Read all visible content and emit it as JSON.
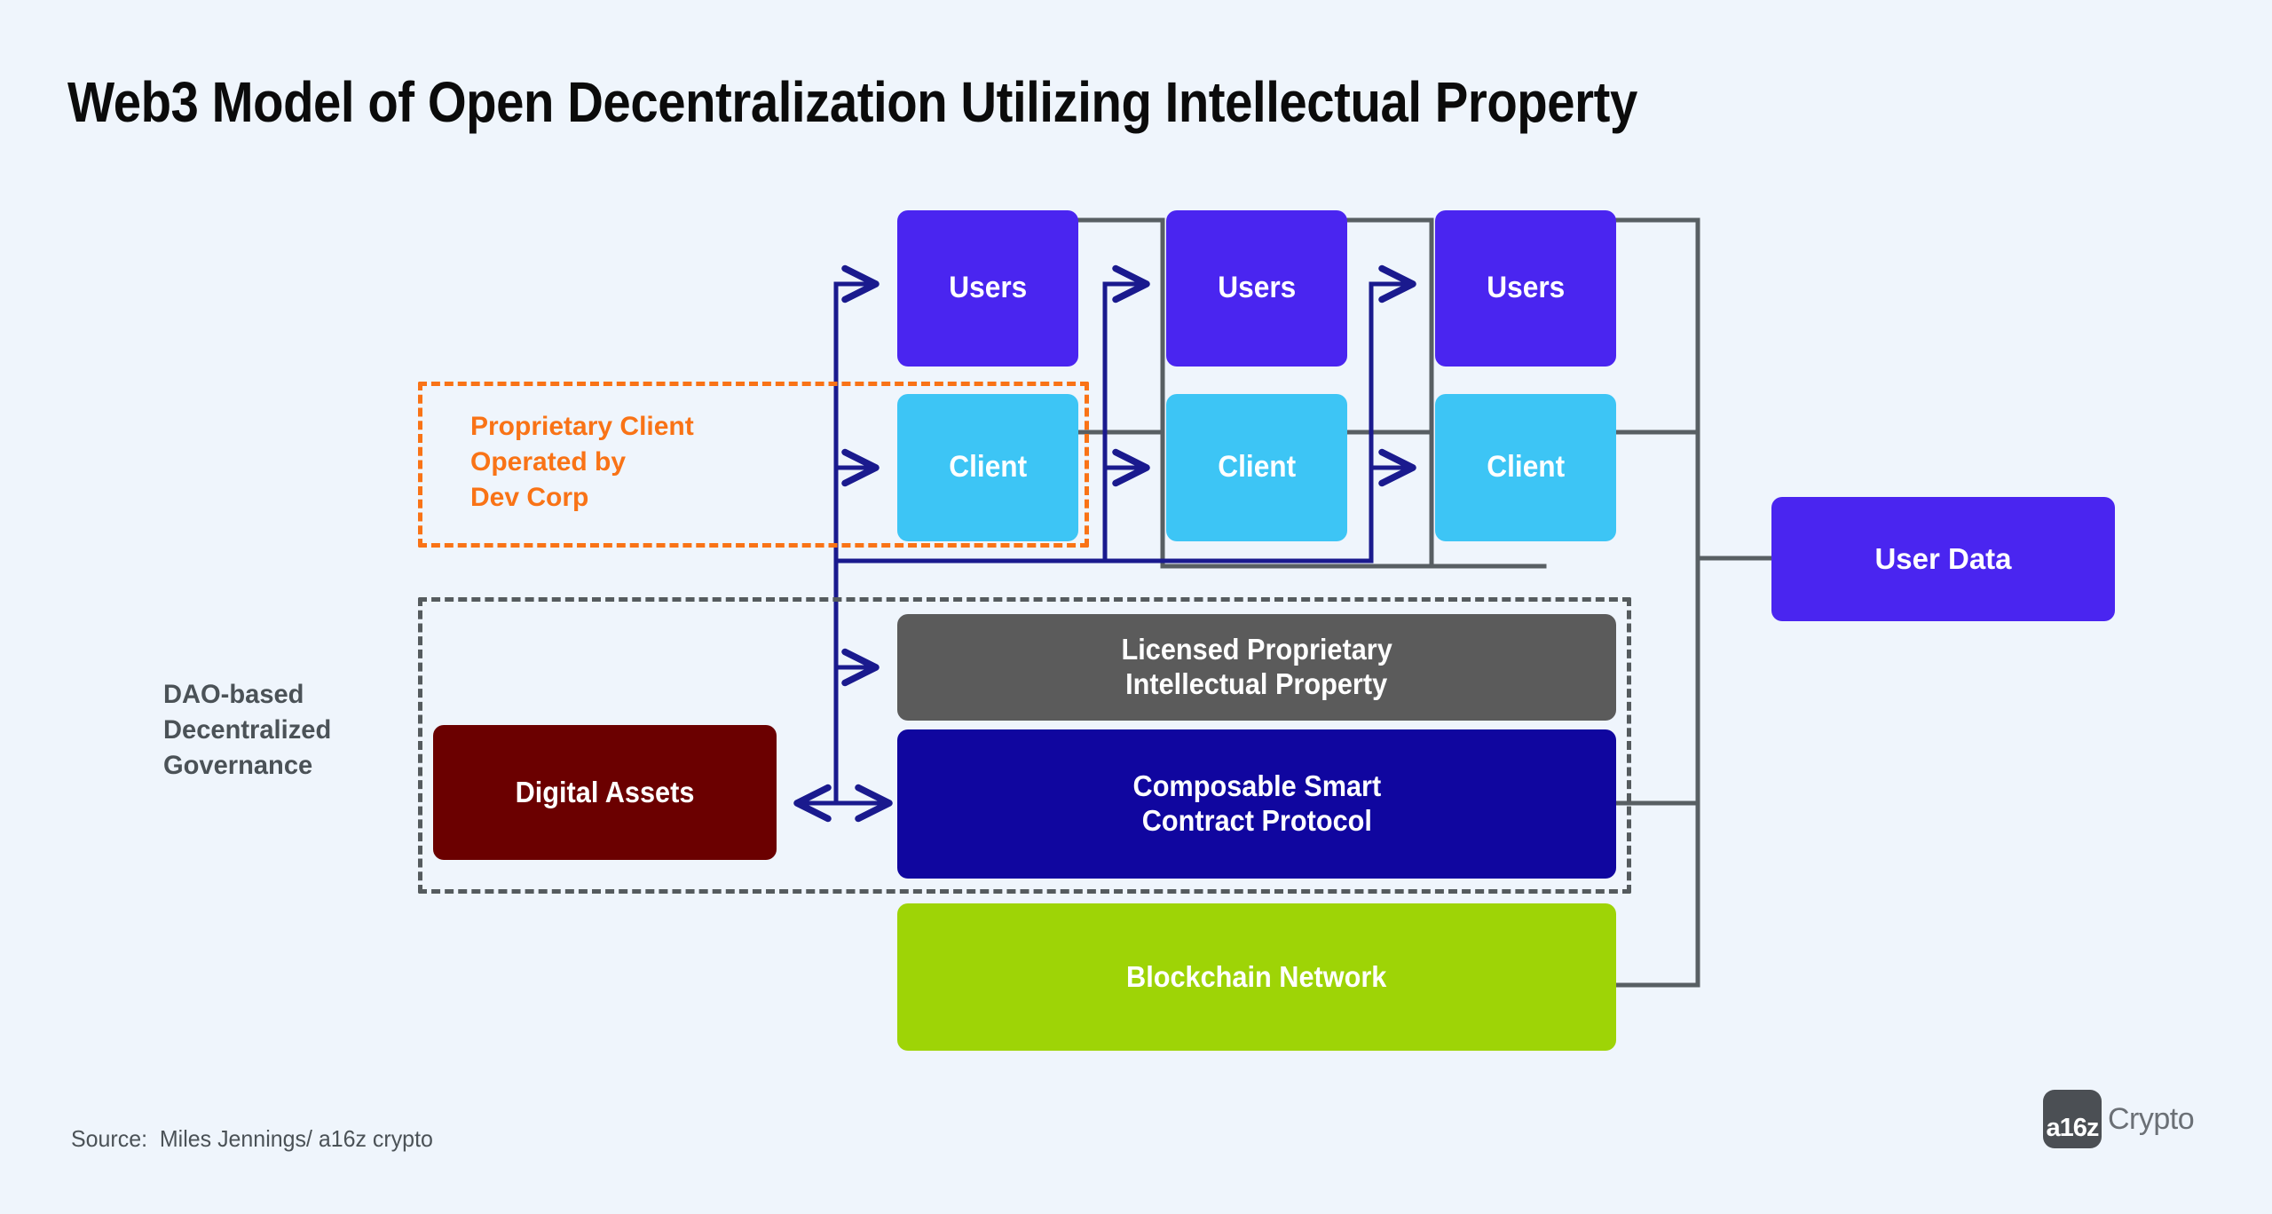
{
  "page": {
    "title": "Web3 Model of Open Decentralization Utilizing Intellectual Property",
    "background_color": "#eff5fc"
  },
  "colors": {
    "users": "#4a25f0",
    "client": "#3dc5f5",
    "licensed_ip": "#5b5b5b",
    "smart_contract": "#10069f",
    "digital_assets": "#6b0000",
    "blockchain": "#9ed406",
    "user_data": "#4a25f0",
    "orange_frame": "#f97316",
    "gray_frame": "#555b5e",
    "navy_arrow": "#1a1a8e",
    "gray_wire": "#585f63",
    "label_gray": "#4b5257"
  },
  "nodes": {
    "users": [
      {
        "label": "Users"
      },
      {
        "label": "Users"
      },
      {
        "label": "Users"
      }
    ],
    "clients": [
      {
        "label": "Client"
      },
      {
        "label": "Client"
      },
      {
        "label": "Client"
      }
    ],
    "licensed_ip": {
      "line1": "Licensed Proprietary",
      "line2": "Intellectual Property"
    },
    "smart_contract": {
      "line1": "Composable Smart",
      "line2": "Contract Protocol"
    },
    "digital_assets": {
      "label": "Digital Assets"
    },
    "blockchain": {
      "label": "Blockchain Network"
    },
    "user_data": {
      "label": "User Data"
    }
  },
  "frames": {
    "proprietary_client": {
      "label": "Proprietary Client\nOperated by\nDev Corp"
    },
    "dao_governance": {
      "label": "DAO-based\nDecentralized\nGovernance"
    }
  },
  "footer": {
    "source": "Source:  Miles Jennings/ a16z crypto",
    "logo_mark": "a16z",
    "logo_word": "Crypto"
  }
}
